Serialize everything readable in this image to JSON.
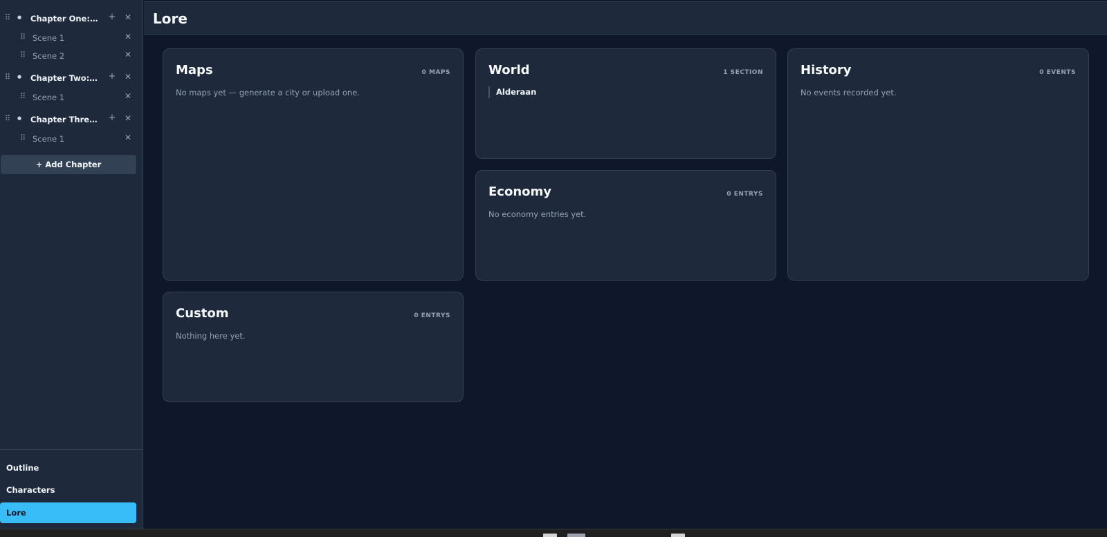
{
  "sidebar": {
    "chapters": [
      {
        "title": "Chapter One: Th...",
        "scenes": [
          "Scene 1",
          "Scene 2"
        ]
      },
      {
        "title": "Chapter Two: Th...",
        "scenes": [
          "Scene 1"
        ]
      },
      {
        "title": "Chapter Three: T...",
        "scenes": [
          "Scene 1"
        ]
      }
    ],
    "add_chapter_label": "+ Add Chapter",
    "nav": [
      {
        "label": "Outline"
      },
      {
        "label": "Characters"
      },
      {
        "label": "Lore"
      }
    ],
    "active_nav": "Lore"
  },
  "header": {
    "title": "Lore"
  },
  "cards": {
    "maps": {
      "title": "Maps",
      "count": "0 MAPS",
      "empty": "No maps yet — generate a city or upload one."
    },
    "world": {
      "title": "World",
      "count": "1 SECTION",
      "items": [
        "Alderaan"
      ]
    },
    "history": {
      "title": "History",
      "count": "0 EVENTS",
      "empty": "No events recorded yet."
    },
    "economy": {
      "title": "Economy",
      "count": "0 ENTRYS",
      "empty": "No economy entries yet."
    },
    "custom": {
      "title": "Custom",
      "count": "0 ENTRYS",
      "empty": "Nothing here yet."
    }
  },
  "colors": {
    "background": "#0f172a",
    "surface": "#1e293b",
    "border": "#334155",
    "accent": "#38bdf8"
  }
}
